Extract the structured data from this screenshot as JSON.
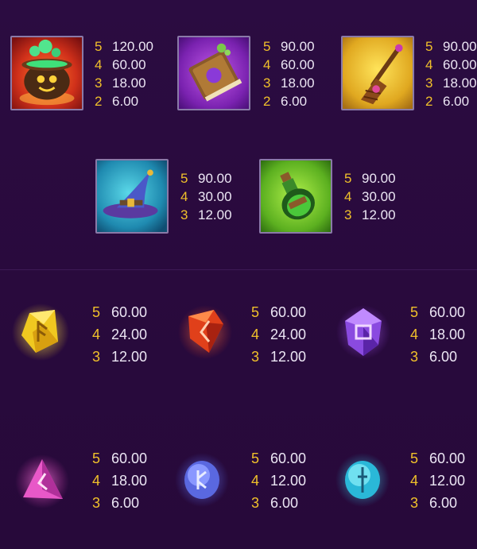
{
  "colors": {
    "background": "#2a0a3e",
    "count_color": "#f0c02a",
    "value_color": "#ece6f4",
    "tile_border": "#8a7aa8"
  },
  "high_symbols": [
    {
      "name": "cauldron-icon",
      "pays": [
        {
          "count": "5",
          "value": "120.00"
        },
        {
          "count": "4",
          "value": "60.00"
        },
        {
          "count": "3",
          "value": "18.00"
        },
        {
          "count": "2",
          "value": "6.00"
        }
      ]
    },
    {
      "name": "spellbook-icon",
      "pays": [
        {
          "count": "5",
          "value": "90.00"
        },
        {
          "count": "4",
          "value": "60.00"
        },
        {
          "count": "3",
          "value": "18.00"
        },
        {
          "count": "2",
          "value": "6.00"
        }
      ]
    },
    {
      "name": "broom-icon",
      "pays": [
        {
          "count": "5",
          "value": "90.00"
        },
        {
          "count": "4",
          "value": "60.00"
        },
        {
          "count": "3",
          "value": "18.00"
        },
        {
          "count": "2",
          "value": "6.00"
        }
      ]
    },
    {
      "name": "witch-hat-icon",
      "pays": [
        {
          "count": "5",
          "value": "90.00"
        },
        {
          "count": "4",
          "value": "30.00"
        },
        {
          "count": "3",
          "value": "12.00"
        }
      ]
    },
    {
      "name": "potion-icon",
      "pays": [
        {
          "count": "5",
          "value": "90.00"
        },
        {
          "count": "4",
          "value": "30.00"
        },
        {
          "count": "3",
          "value": "12.00"
        }
      ]
    }
  ],
  "low_symbols": [
    {
      "name": "yellow-rune-gem-icon",
      "pays": [
        {
          "count": "5",
          "value": "60.00"
        },
        {
          "count": "4",
          "value": "24.00"
        },
        {
          "count": "3",
          "value": "12.00"
        }
      ]
    },
    {
      "name": "red-rune-gem-icon",
      "pays": [
        {
          "count": "5",
          "value": "60.00"
        },
        {
          "count": "4",
          "value": "24.00"
        },
        {
          "count": "3",
          "value": "12.00"
        }
      ]
    },
    {
      "name": "purple-rune-gem-icon",
      "pays": [
        {
          "count": "5",
          "value": "60.00"
        },
        {
          "count": "4",
          "value": "18.00"
        },
        {
          "count": "3",
          "value": "6.00"
        }
      ]
    },
    {
      "name": "pink-triangle-rune-icon",
      "pays": [
        {
          "count": "5",
          "value": "60.00"
        },
        {
          "count": "4",
          "value": "18.00"
        },
        {
          "count": "3",
          "value": "6.00"
        }
      ]
    },
    {
      "name": "blue-round-rune-icon",
      "pays": [
        {
          "count": "5",
          "value": "60.00"
        },
        {
          "count": "4",
          "value": "12.00"
        },
        {
          "count": "3",
          "value": "6.00"
        }
      ]
    },
    {
      "name": "cyan-round-rune-icon",
      "pays": [
        {
          "count": "5",
          "value": "60.00"
        },
        {
          "count": "4",
          "value": "12.00"
        },
        {
          "count": "3",
          "value": "6.00"
        }
      ]
    }
  ]
}
